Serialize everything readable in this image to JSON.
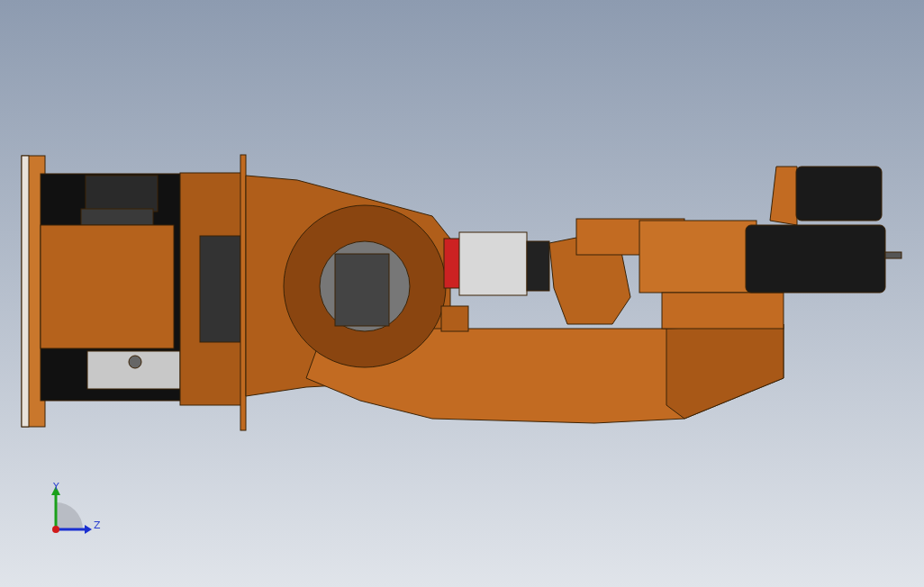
{
  "viewport": {
    "triad": {
      "y_label": "Y",
      "z_label": "Z"
    }
  }
}
